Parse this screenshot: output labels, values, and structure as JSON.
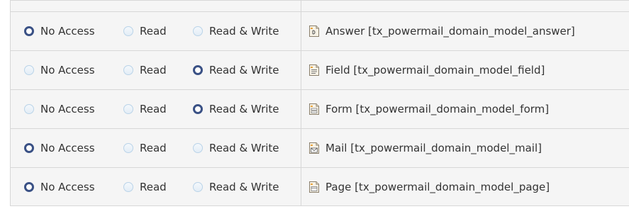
{
  "options": {
    "no_access": "No Access",
    "read": "Read",
    "read_write": "Read & Write"
  },
  "rows": [
    {
      "table": "Answer [tx_powermail_domain_model_answer]",
      "icon": "answer-record-icon",
      "selected": "no_access"
    },
    {
      "table": "Field [tx_powermail_domain_model_field]",
      "icon": "field-record-icon",
      "selected": "read_write"
    },
    {
      "table": "Form [tx_powermail_domain_model_form]",
      "icon": "form-record-icon",
      "selected": "read_write"
    },
    {
      "table": "Mail [tx_powermail_domain_model_mail]",
      "icon": "mail-record-icon",
      "selected": "no_access"
    },
    {
      "table": "Page [tx_powermail_domain_model_page]",
      "icon": "page-record-icon",
      "selected": "no_access"
    }
  ],
  "colors": {
    "panel_bg": "#f5f5f5",
    "border": "#d7d7d7",
    "radio_checked": "#3a5185",
    "radio_unchecked_border": "#b9d3e8",
    "icon_accent": "#e8a33c"
  }
}
